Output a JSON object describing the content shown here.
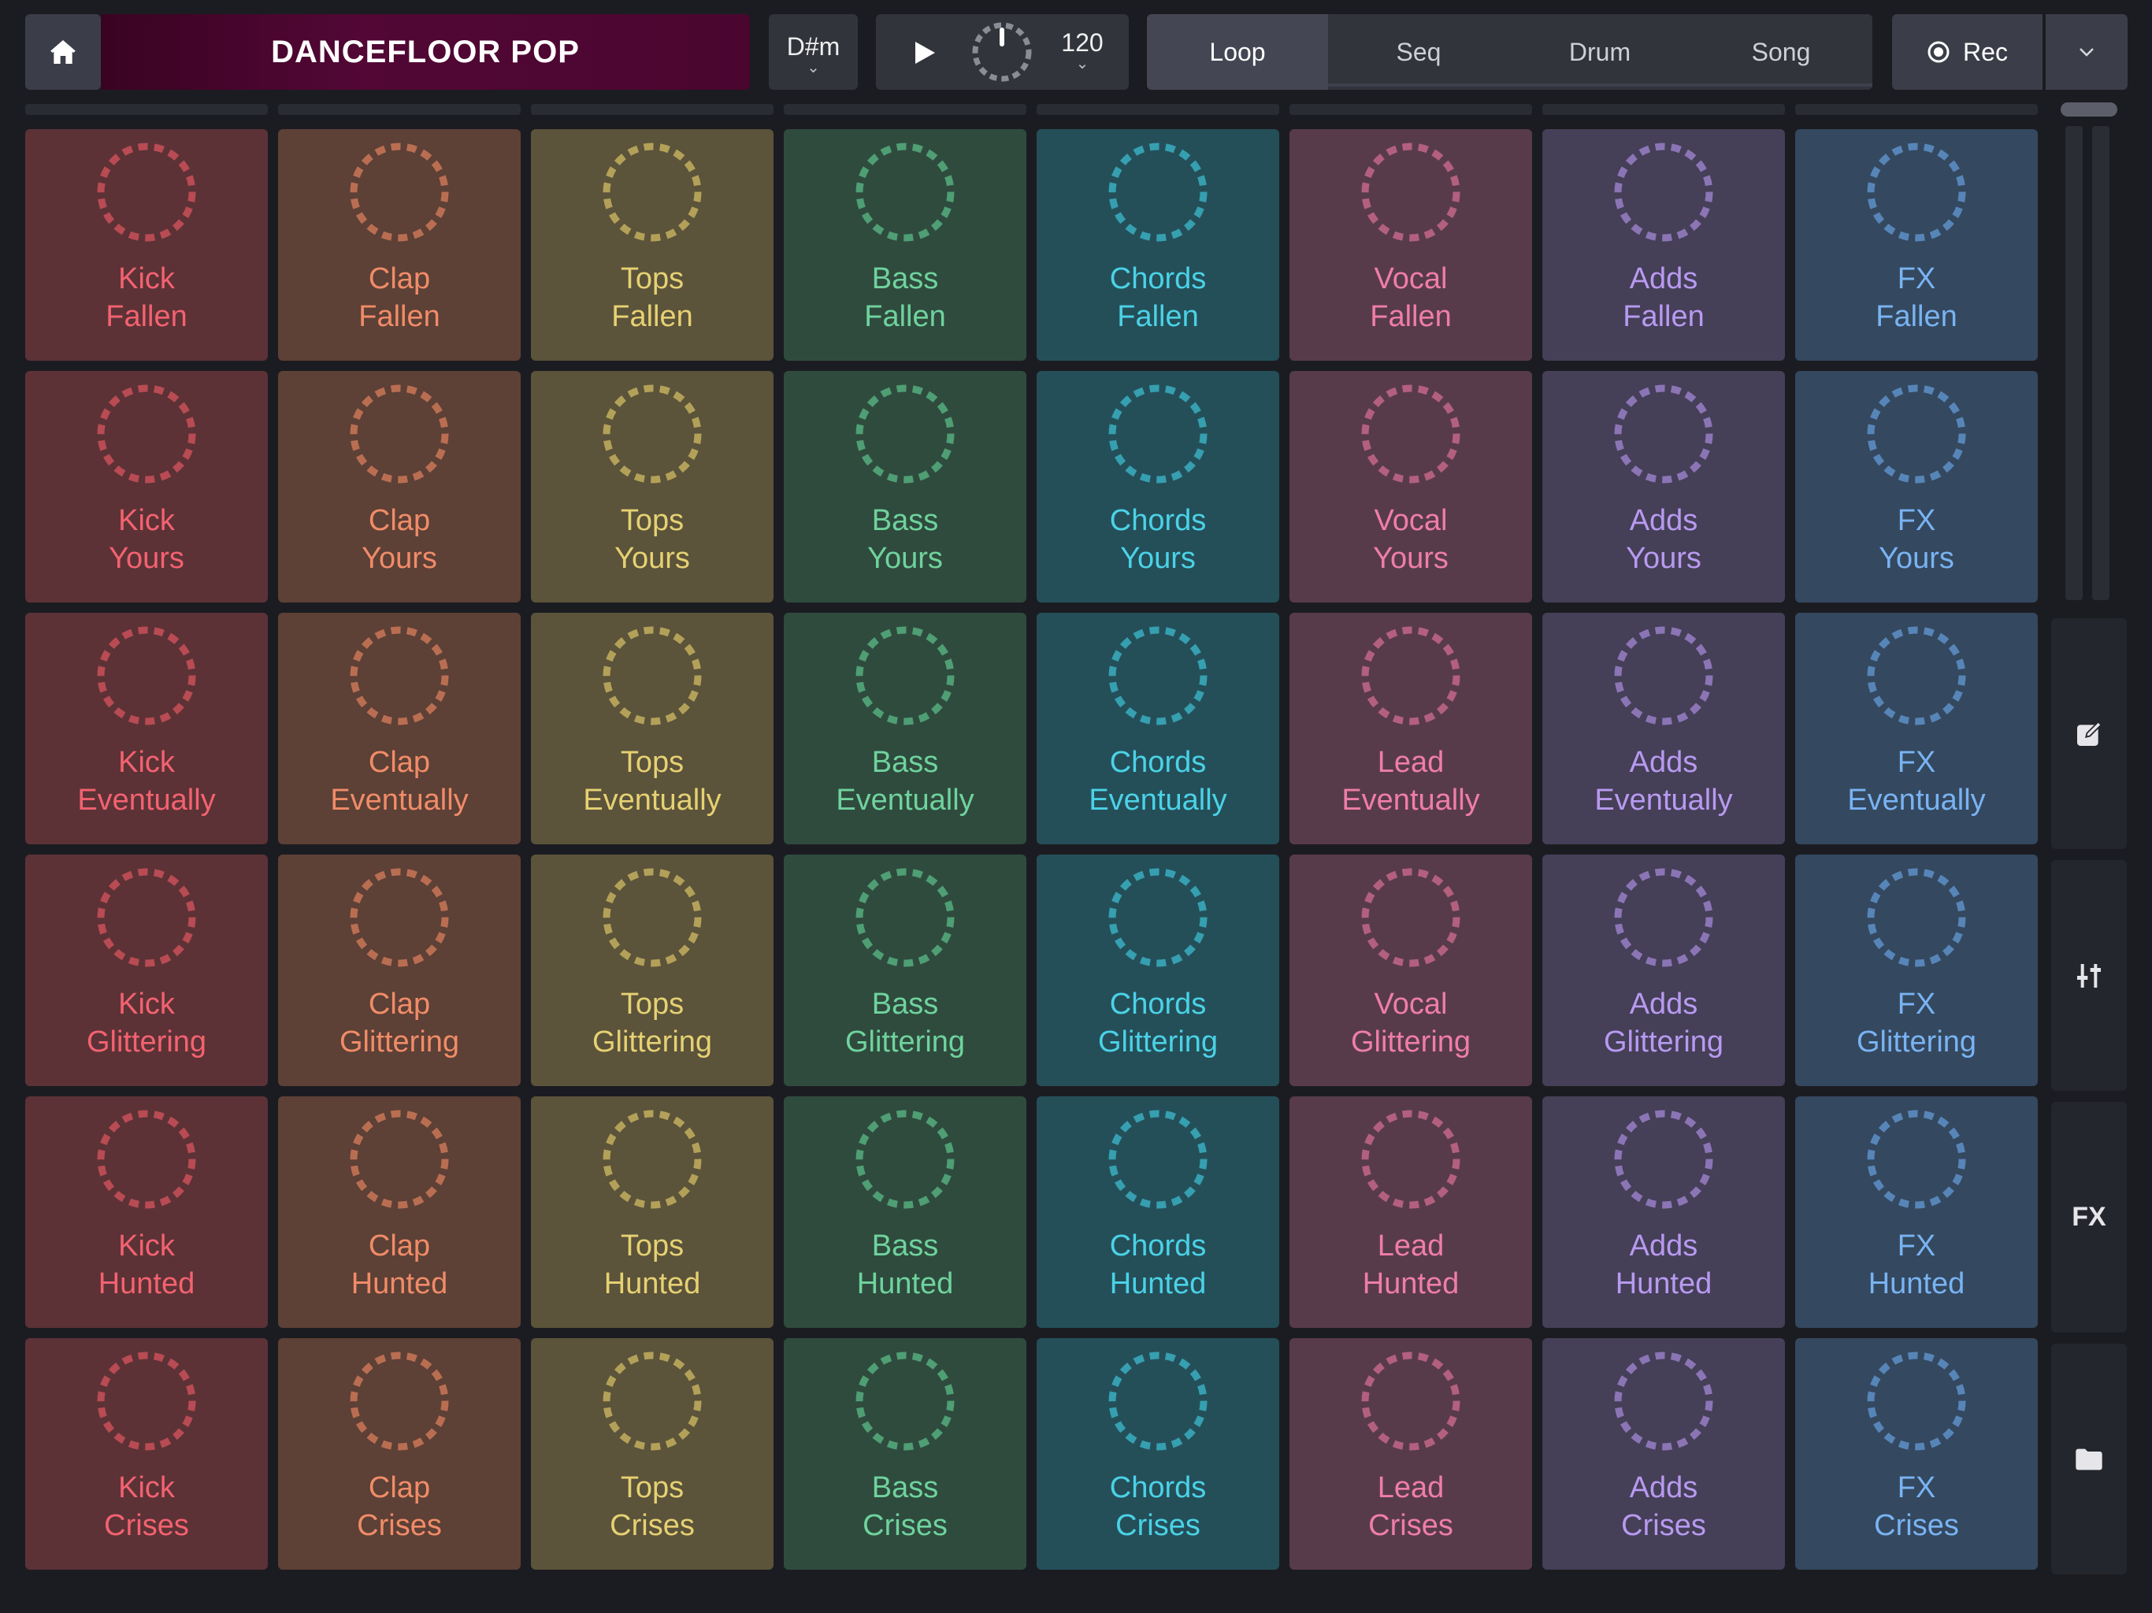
{
  "header": {
    "project_title": "DANCEFLOOR POP",
    "key": "D#m",
    "tempo": "120",
    "tabs": [
      {
        "label": "Loop",
        "active": true
      },
      {
        "label": "Seq",
        "active": false
      },
      {
        "label": "Drum",
        "active": false
      },
      {
        "label": "Song",
        "active": false
      }
    ],
    "rec_label": "Rec"
  },
  "icons": {
    "home": "home-icon",
    "play": "play-icon",
    "record": "record-icon",
    "expand": "chevron-down-icon",
    "edit": "edit-icon",
    "mixer": "mixer-icon",
    "folder": "folder-icon"
  },
  "sidebar": {
    "fx_label": "FX"
  },
  "columns": [
    {
      "name": "Kick",
      "bg": "#5c3236",
      "fg": "#f36270",
      "ring": "#b84b53"
    },
    {
      "name": "Clap",
      "bg": "#5d4036",
      "fg": "#f08c68",
      "ring": "#b96e52"
    },
    {
      "name": "Tops",
      "bg": "#5b533a",
      "fg": "#e6d173",
      "ring": "#b3a159"
    },
    {
      "name": "Bass",
      "bg": "#2f4b3e",
      "fg": "#6fd39d",
      "ring": "#4f9e74"
    },
    {
      "name": "Chords",
      "bg": "#244f59",
      "fg": "#4bd2e6",
      "ring": "#369fb0"
    },
    {
      "name": "Vocal",
      "bg": "#583b4b",
      "fg": "#ef7ea6",
      "ring": "#b3607f"
    },
    {
      "name": "Adds",
      "bg": "#453f58",
      "fg": "#b89af0",
      "ring": "#8b75b5"
    },
    {
      "name": "FX",
      "bg": "#34485f",
      "fg": "#79b3f2",
      "ring": "#5785b8"
    }
  ],
  "pads": [
    [
      "Kick\nFallen",
      "Clap\nFallen",
      "Tops\nFallen",
      "Bass\nFallen",
      "Chords\nFallen",
      "Vocal\nFallen",
      "Adds\nFallen",
      "FX\nFallen"
    ],
    [
      "Kick\nYours",
      "Clap\nYours",
      "Tops\nYours",
      "Bass\nYours",
      "Chords\nYours",
      "Vocal\nYours",
      "Adds\nYours",
      "FX\nYours"
    ],
    [
      "Kick\nEventually",
      "Clap\nEventually",
      "Tops\nEventually",
      "Bass\nEventually",
      "Chords\nEventually",
      "Lead\nEventually",
      "Adds\nEventually",
      "FX\nEventually"
    ],
    [
      "Kick\nGlittering",
      "Clap\nGlittering",
      "Tops\nGlittering",
      "Bass\nGlittering",
      "Chords\nGlittering",
      "Vocal\nGlittering",
      "Adds\nGlittering",
      "FX\nGlittering"
    ],
    [
      "Kick\nHunted",
      "Clap\nHunted",
      "Tops\nHunted",
      "Bass\nHunted",
      "Chords\nHunted",
      "Lead\nHunted",
      "Adds\nHunted",
      "FX\nHunted"
    ],
    [
      "Kick\nCrises",
      "Clap\nCrises",
      "Tops\nCrises",
      "Bass\nCrises",
      "Chords\nCrises",
      "Lead\nCrises",
      "Adds\nCrises",
      "FX\nCrises"
    ]
  ]
}
